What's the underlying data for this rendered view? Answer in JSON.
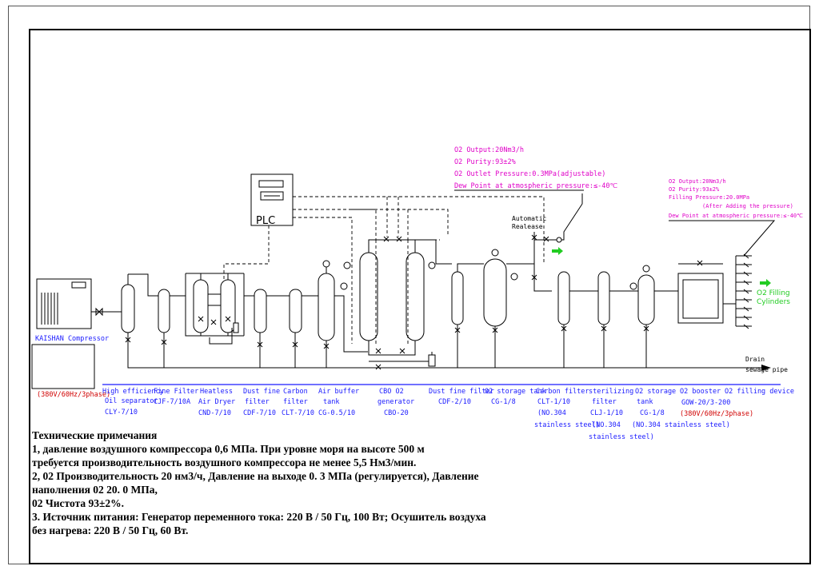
{
  "compressor": {
    "name": "KAISHAN Compressor",
    "power": "(380V/60Hz/3phase)"
  },
  "plc": "PLC",
  "release": {
    "line1": "Automatic",
    "line2": "Realease"
  },
  "output_spec": {
    "line1": "O2 Output:20Nm3/h",
    "line2": "O2 Purity:93±2%",
    "line3": "O2 Outlet Pressure:0.3MPa(adjustable)",
    "line4": "Dew Point at atmospheric pressure:≤-40℃"
  },
  "filling_spec": {
    "line1": "O2 Output:20Nm3/h",
    "line2": "O2 Purity:93±2%",
    "line3": "Filling Pressure:20.0MPa",
    "line4": "(After Adding the pressure)",
    "line5": "Dew Point at atmospheric pressure:≤-40℃"
  },
  "filling_label": {
    "line1": "O2 Filling",
    "line2": "Cylinders"
  },
  "drain": {
    "line1": "Drain",
    "line2": "sewage pipe"
  },
  "equipment": {
    "oil_sep": {
      "l1": "High efficiency",
      "l2": "Oil separator",
      "l3": "CLY-7/10"
    },
    "fine_filter": {
      "l1": "Fine Filter",
      "l2": "CJF-7/10A"
    },
    "dryer": {
      "l1": "Heatless",
      "l2": "Air Dryer",
      "l3": "CND-7/10"
    },
    "dust_filter": {
      "l1": "Dust fine",
      "l2": "filter",
      "l3": "CDF-7/10"
    },
    "carbon_filter": {
      "l1": "Carbon",
      "l2": "filter",
      "l3": "CLT-7/10"
    },
    "air_buffer": {
      "l1": "Air buffer",
      "l2": "tank",
      "l3": "CG-0.5/10"
    },
    "generator": {
      "l1": "CBO O2",
      "l2": "generator",
      "l3": "CBO-20"
    },
    "dust_filter2": {
      "l1": "Dust fine filter",
      "l2": "CDF-2/10"
    },
    "o2_tank": {
      "l1": "O2 storage tank",
      "l2": "CG-1/8"
    },
    "carbon_filter2": {
      "l1": "Carbon filter",
      "l2": "CLT-1/10",
      "l3": "(NO.304",
      "l4": "stainless steel)"
    },
    "sterilizing": {
      "l1": "sterilizing",
      "l2": "filter",
      "l3": "CLJ-1/10",
      "l4": "(NO.304",
      "l5": "stainless steel)"
    },
    "o2_tank2": {
      "l1": "O2 storage",
      "l2": "tank",
      "l3": "CG-1/8",
      "l4": "(NO.304 stainless steel)"
    },
    "booster": {
      "l1": "O2 booster",
      "l2": "GOW-20/3-200",
      "l3": "(380V/60Hz/3phase)"
    },
    "filling_device": {
      "l1": "O2 filling device"
    }
  },
  "notes": [
    "Технические примечания",
    "1, давление воздушного компрессора 0,6 МПа. При уровне моря на высоте 500 м",
    "требуется производительность воздушного компрессора не менее 5,5 Нм3/мин.",
    "2, 02 Производительность 20 нм3/ч, Давление на выходе 0. 3 МПа (регулируется), Давление",
    "наполнения 02 20. 0 МПа,",
    "02 Чистота 93±2%.",
    "3. Источник питания: Генератор переменного тока: 220 В / 50 Гц, 100 Вт; Осушитель воздуха",
    "без нагрева: 220 В / 50 Гц, 60 Вт."
  ]
}
